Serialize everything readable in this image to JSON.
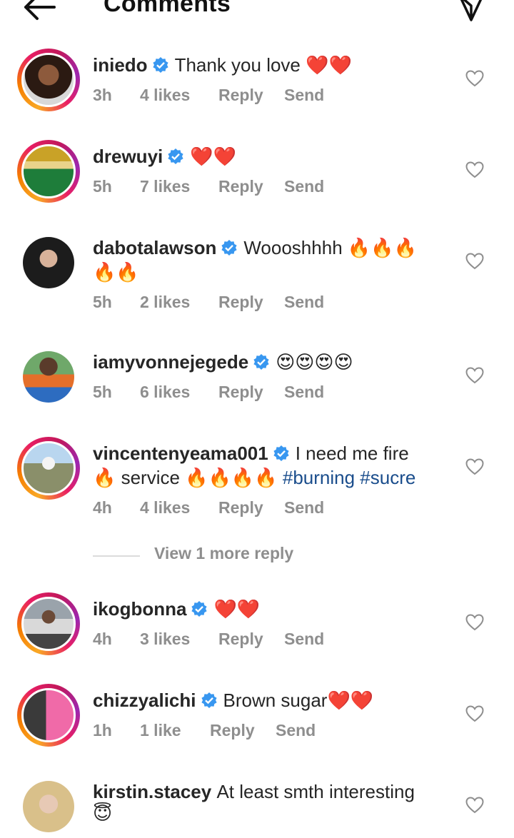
{
  "header": {
    "title": "Comments",
    "back_icon": "arrow-left-icon",
    "send_icon": "paper-plane-icon"
  },
  "colors": {
    "verified": "#3897f0",
    "meta": "#8e8e8e",
    "hashtag": "#1a4d8c",
    "heart_emoji": "#e0245e"
  },
  "comments": [
    {
      "username": "iniedo",
      "verified": true,
      "text": "Thank you love ❤️❤️",
      "time": "3h",
      "likes": "4 likes",
      "reply": "Reply",
      "send": "Send"
    },
    {
      "username": "drewuyi",
      "verified": true,
      "text": "❤️❤️",
      "time": "5h",
      "likes": "7 likes",
      "reply": "Reply",
      "send": "Send"
    },
    {
      "username": "dabotalawson",
      "verified": true,
      "text": "Woooshhhh 🔥🔥🔥",
      "text2": "🔥🔥",
      "time": "5h",
      "likes": "2 likes",
      "reply": "Reply",
      "send": "Send"
    },
    {
      "username": "iamyvonnejegede",
      "verified": true,
      "text": "😍😍😍😍",
      "time": "5h",
      "likes": "6 likes",
      "reply": "Reply",
      "send": "Send"
    },
    {
      "username": "vincentenyeama001",
      "verified": true,
      "text": "I need me fire",
      "text2_prefix": "🔥 service 🔥🔥🔥🔥 ",
      "hashtags": "#burning #sucre",
      "time": "4h",
      "likes": "4 likes",
      "reply": "Reply",
      "send": "Send"
    },
    {
      "username": "ikogbonna",
      "verified": true,
      "text": "❤️❤️",
      "time": "4h",
      "likes": "3 likes",
      "reply": "Reply",
      "send": "Send"
    },
    {
      "username": "chizzyalichi",
      "verified": true,
      "text": "Brown sugar❤️❤️",
      "time": "1h",
      "likes": "1 like",
      "reply": "Reply",
      "send": "Send"
    },
    {
      "username": "kirstin.stacey",
      "verified": false,
      "text": "At least smth interesting",
      "text2": "😇"
    }
  ],
  "more_replies": "View 1 more reply"
}
